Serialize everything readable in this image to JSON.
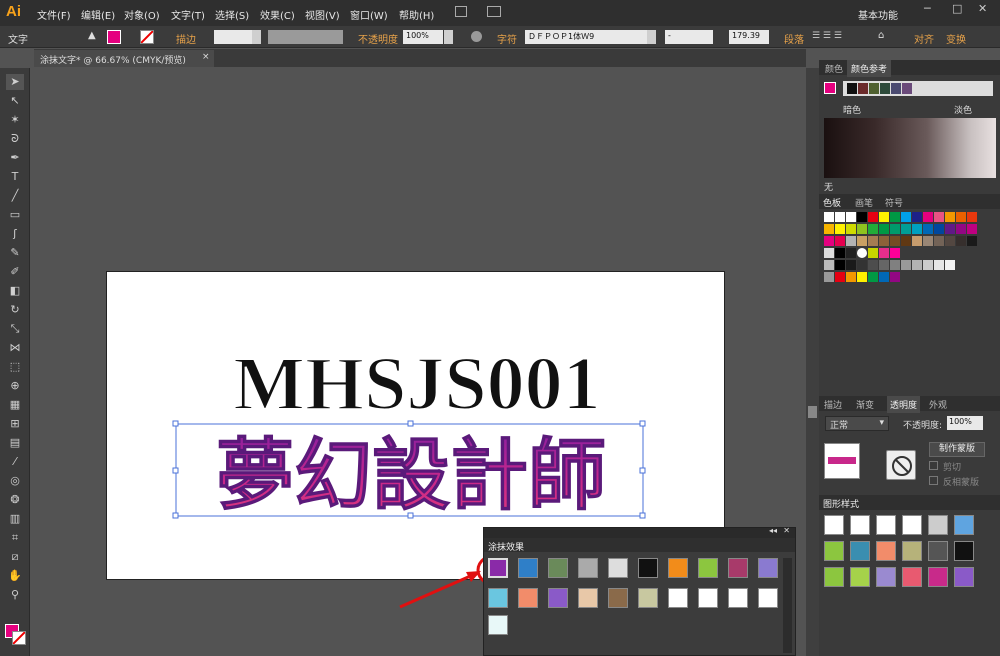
{
  "app": {
    "logo": "Ai"
  },
  "menu": [
    "文件(F)",
    "编辑(E)",
    "对象(O)",
    "文字(T)",
    "选择(S)",
    "效果(C)",
    "视图(V)",
    "窗口(W)",
    "帮助(H)"
  ],
  "workspace": "基本功能",
  "control": {
    "tool_label": "文字",
    "stroke_label": "描边",
    "opacity_label": "不透明度",
    "opacity_value": "100%",
    "char_label": "字符",
    "font_name": "ＤＦＰＯＰ1体Ｗ9",
    "font_style": "-",
    "font_size": "179.39",
    "para_label": "段落",
    "align_label": "对齐",
    "transform_label": "变换"
  },
  "doc_tab": "涂抹文字* @ 66.67% (CMYK/预览)",
  "artwork": {
    "line1": "MHSJS001",
    "line2": "夢幻設計師"
  },
  "color_guide": {
    "tab1": "颜色",
    "tab2": "颜色参考",
    "left_label": "暗色",
    "right_label": "淡色",
    "none_label": "无"
  },
  "swatch_panel": {
    "tab1": "色板",
    "tab2": "画笔",
    "tab3": "符号"
  },
  "transparency_panel": {
    "tab1": "描边",
    "tab2": "渐变",
    "tab3": "透明度",
    "tab4": "外观",
    "mode": "正常",
    "opacity_label": "不透明度:",
    "opacity_value": "100%",
    "make_mask": "制作蒙版",
    "clip": "剪切",
    "invert": "反相蒙版"
  },
  "graphic_styles": {
    "title": "图形样式"
  },
  "scribble_panel": {
    "title": "涂抹效果"
  },
  "colors": {
    "accent": "#e7a24a",
    "fill": "#e5007f"
  }
}
